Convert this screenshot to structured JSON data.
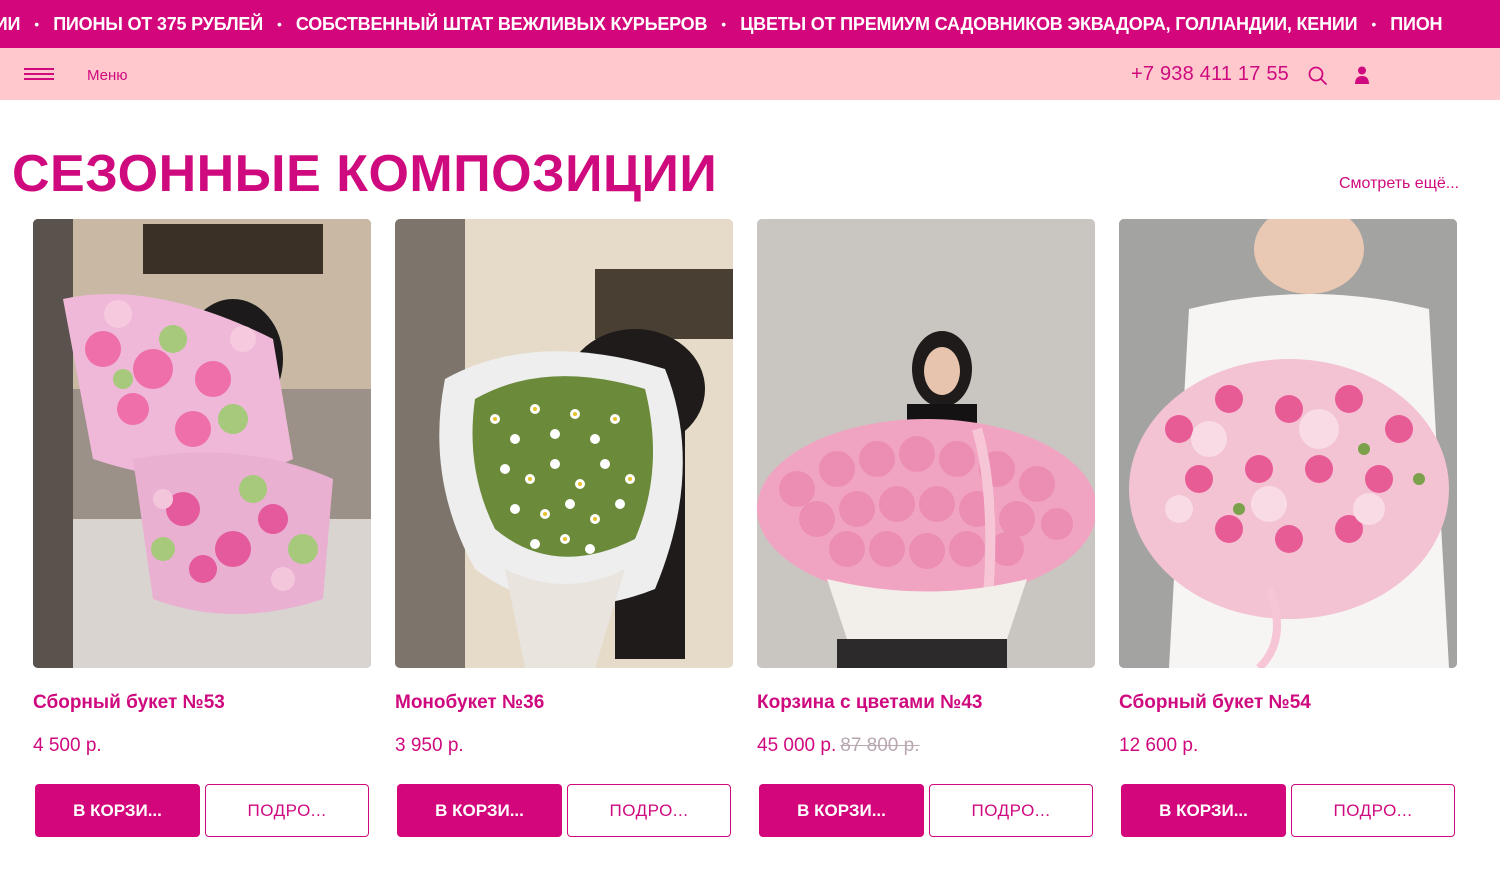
{
  "ticker": {
    "items": [
      "НИИ",
      "ПИОНЫ ОТ 375 РУБЛЕЙ",
      "СОБСТВЕННЫЙ ШТАТ ВЕЖЛИВЫХ КУРЬЕРОВ",
      "ЦВЕТЫ ОТ ПРЕМИУМ САДОВНИКОВ ЭКВАДОРА, ГОЛЛАНДИИ, КЕНИИ",
      "ПИОН"
    ],
    "separator": "•"
  },
  "header": {
    "menu_label": "Меню",
    "phone": "+7 938 411 17 55",
    "icons": [
      "menu-icon",
      "search-icon",
      "user-icon"
    ]
  },
  "section": {
    "title": "СЕЗОННЫЕ КОМПОЗИЦИИ",
    "see_more": "Смотреть ещё..."
  },
  "products": [
    {
      "name": "Сборный букет №53",
      "price": "4 500 р.",
      "old_price": "",
      "cart_label": "В КОРЗИ...",
      "more_label": "ПОДРО...",
      "image": "photo-mixed-bouquets"
    },
    {
      "name": "Монобукет №36",
      "price": "3 950 р.",
      "old_price": "",
      "cart_label": "В КОРЗИ...",
      "more_label": "ПОДРО...",
      "image": "photo-chamomile-bouquet"
    },
    {
      "name": "Корзина с цветами №43",
      "price": "45 000 р.",
      "old_price": "87 800 р.",
      "cart_label": "В КОРЗИ...",
      "more_label": "ПОДРО...",
      "image": "photo-peony-basket"
    },
    {
      "name": "Сборный букет №54",
      "price": "12 600 р.",
      "old_price": "",
      "cart_label": "В КОРЗИ...",
      "more_label": "ПОДРО...",
      "image": "photo-pink-bouquet"
    }
  ],
  "colors": {
    "accent": "#d4067b",
    "header_bg": "#ffc8cd",
    "old_price": "#b9a7b1"
  }
}
